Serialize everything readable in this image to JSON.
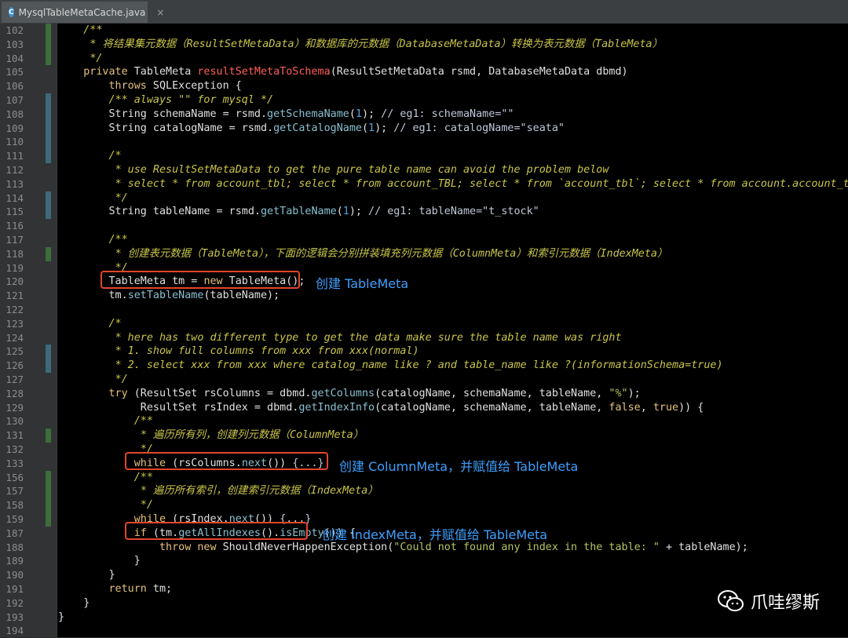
{
  "tab": {
    "icon_letter": "C",
    "title": "MysqlTableMetaCache.java",
    "close": "×"
  },
  "lines": [
    {
      "n": "102",
      "html": "    <span class=\"cm\">/**</span>"
    },
    {
      "n": "103",
      "html": "     <span class=\"cm\">* 将结果集元数据（ResultSetMetaData）和数据库的元数据（DatabaseMetaData）转换为表元数据（TableMeta）</span>"
    },
    {
      "n": "104",
      "html": "     <span class=\"cm\">*/</span>"
    },
    {
      "n": "105",
      "html": "    <span class=\"k\">private</span> TableMeta <span class=\"fn\">resultSetMetaToSchema</span>(ResultSetMetaData rsmd, DatabaseMetaData dbmd)"
    },
    {
      "n": "106",
      "html": "        <span class=\"k\">throws</span> SQLException {"
    },
    {
      "n": "107",
      "html": "        <span class=\"cm\">/** always \"\" for mysql */</span>"
    },
    {
      "n": "108",
      "html": "        String schemaName = rsmd.<span class=\"m\">getSchemaName</span>(<span class=\"num\">1</span>); <span class=\"ty\">// eg1: schemaName=\"\"</span>"
    },
    {
      "n": "109",
      "html": "        String catalogName = rsmd.<span class=\"m\">getCatalogName</span>(<span class=\"num\">1</span>); <span class=\"ty\">// eg1: catalogName=\"seata\"</span>"
    },
    {
      "n": "110",
      "html": ""
    },
    {
      "n": "111",
      "html": "        <span class=\"cm\">/*</span>"
    },
    {
      "n": "112",
      "html": "         <span class=\"cm\">* use ResultSetMetaData to get the pure table name can avoid the problem below</span>"
    },
    {
      "n": "113",
      "html": "         <span class=\"cm\">* select * from account_tbl; select * from account_TBL; select * from `account_tbl`; select * from account.account_tbl</span>"
    },
    {
      "n": "114",
      "html": "         <span class=\"cm\">*/</span>"
    },
    {
      "n": "115",
      "html": "        String tableName = rsmd.<span class=\"m\">getTableName</span>(<span class=\"num\">1</span>); <span class=\"ty\">// eg1: tableName=\"t_stock\"</span>"
    },
    {
      "n": "116",
      "html": ""
    },
    {
      "n": "117",
      "html": "        <span class=\"cm\">/**</span>"
    },
    {
      "n": "118",
      "html": "         <span class=\"cm\">* 创建表元数据（TableMeta），下面的逻辑会分别拼装填充列元数据（ColumnMeta）和索引元数据（IndexMeta）</span>"
    },
    {
      "n": "119",
      "html": "         <span class=\"cm\">*/</span>"
    },
    {
      "n": "120",
      "html": "        TableMeta tm = <span class=\"k\">new</span> TableMeta();"
    },
    {
      "n": "121",
      "html": "        tm.<span class=\"m\">setTableName</span>(tableName);"
    },
    {
      "n": "122",
      "html": ""
    },
    {
      "n": "123",
      "html": "        <span class=\"cm\">/*</span>"
    },
    {
      "n": "124",
      "html": "         <span class=\"cm\">* here has two different type to get the data make sure the table name was right</span>"
    },
    {
      "n": "125",
      "html": "         <span class=\"cm\">* 1. show full columns from xxx from xxx(normal)</span>"
    },
    {
      "n": "126",
      "html": "         <span class=\"cm\">* 2. select xxx from xxx where catalog_name like ? and table_name like ?(informationSchema=true)</span>"
    },
    {
      "n": "127",
      "html": "         <span class=\"cm\">*/</span>"
    },
    {
      "n": "128",
      "html": "        <span class=\"k\">try</span> (ResultSet rsColumns = dbmd.<span class=\"m\">getColumns</span>(catalogName, schemaName, tableName, <span class=\"s\">\"%\"</span>);"
    },
    {
      "n": "129",
      "html": "             ResultSet rsIndex = dbmd.<span class=\"m\">getIndexInfo</span>(catalogName, schemaName, tableName, <span class=\"k\">false</span>, <span class=\"k\">true</span>)) {"
    },
    {
      "n": "130",
      "html": "            <span class=\"cm\">/**</span>"
    },
    {
      "n": "131",
      "html": "             <span class=\"cm\">* 遍历所有列，创建列元数据（ColumnMeta）</span>"
    },
    {
      "n": "132",
      "html": "             <span class=\"cm\">*/</span>"
    },
    {
      "n": "133",
      "html": "            <span class=\"k\">while</span> (rsColumns.<span class=\"m\">next</span>()) <span class=\"ty\">{...}</span>"
    },
    {
      "n": "156",
      "html": "            <span class=\"cm\">/**</span>"
    },
    {
      "n": "157",
      "html": "             <span class=\"cm\">* 遍历所有索引，创建索引元数据（IndexMeta）</span>"
    },
    {
      "n": "158",
      "html": "             <span class=\"cm\">*/</span>"
    },
    {
      "n": "159",
      "html": "            <span class=\"k\">while</span> (rsIndex.<span class=\"m\">next</span>()) <span class=\"ty\">{...}</span>"
    },
    {
      "n": "187",
      "html": "            <span class=\"k\">if</span> (tm.<span class=\"m\">getAllIndexes</span>().<span class=\"m\">isEmpty</span>()) {"
    },
    {
      "n": "188",
      "html": "                <span class=\"k\">throw new</span> ShouldNeverHappenException(<span class=\"s\">\"Could not found any index in the table: \"</span> + tableName);"
    },
    {
      "n": "189",
      "html": "            }"
    },
    {
      "n": "190",
      "html": "        }"
    },
    {
      "n": "191",
      "html": "        <span class=\"k\">return</span> tm;"
    },
    {
      "n": "192",
      "html": "    }"
    },
    {
      "n": "193",
      "html": "}"
    },
    {
      "n": "194",
      "html": ""
    }
  ],
  "annotations": {
    "a1": "创建 TableMeta",
    "a2": "创建 ColumnMeta，并赋值给 TableMeta",
    "a3": "创建 IndexMeta，并赋值给 TableMeta"
  },
  "watermark": {
    "text": "爪哇缪斯"
  }
}
